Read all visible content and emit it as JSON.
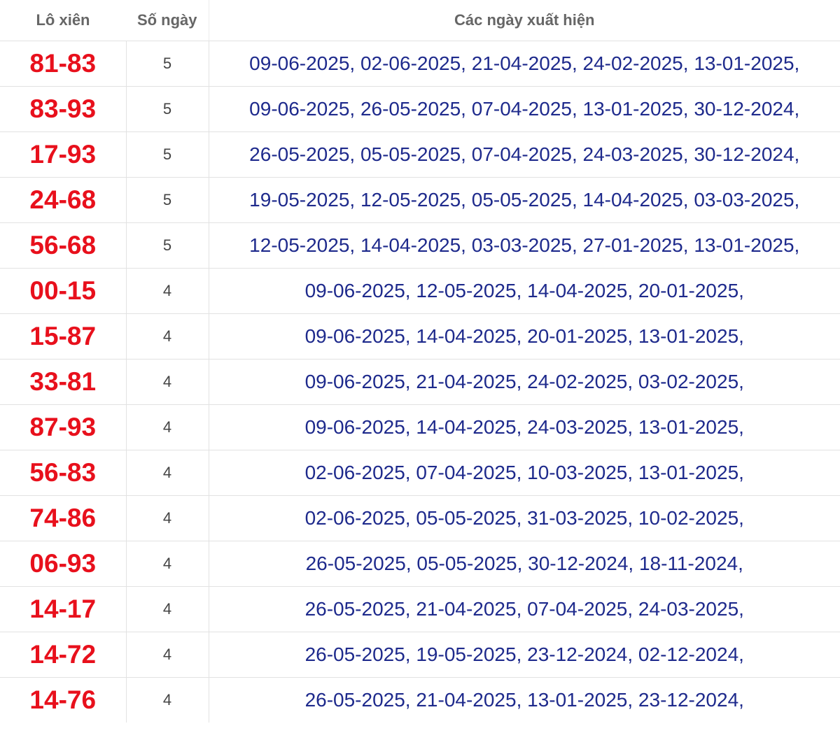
{
  "header": {
    "pair_label": "Lô xiên",
    "count_label": "Số ngày",
    "dates_label": "Các ngày xuất hiện"
  },
  "rows": [
    {
      "pair": "81-83",
      "count": "5",
      "dates": "09-06-2025, 02-06-2025, 21-04-2025, 24-02-2025, 13-01-2025,"
    },
    {
      "pair": "83-93",
      "count": "5",
      "dates": "09-06-2025, 26-05-2025, 07-04-2025, 13-01-2025, 30-12-2024,"
    },
    {
      "pair": "17-93",
      "count": "5",
      "dates": "26-05-2025, 05-05-2025, 07-04-2025, 24-03-2025, 30-12-2024,"
    },
    {
      "pair": "24-68",
      "count": "5",
      "dates": "19-05-2025, 12-05-2025, 05-05-2025, 14-04-2025, 03-03-2025,"
    },
    {
      "pair": "56-68",
      "count": "5",
      "dates": "12-05-2025, 14-04-2025, 03-03-2025, 27-01-2025, 13-01-2025,"
    },
    {
      "pair": "00-15",
      "count": "4",
      "dates": "09-06-2025, 12-05-2025, 14-04-2025, 20-01-2025,"
    },
    {
      "pair": "15-87",
      "count": "4",
      "dates": "09-06-2025, 14-04-2025, 20-01-2025, 13-01-2025,"
    },
    {
      "pair": "33-81",
      "count": "4",
      "dates": "09-06-2025, 21-04-2025, 24-02-2025, 03-02-2025,"
    },
    {
      "pair": "87-93",
      "count": "4",
      "dates": "09-06-2025, 14-04-2025, 24-03-2025, 13-01-2025,"
    },
    {
      "pair": "56-83",
      "count": "4",
      "dates": "02-06-2025, 07-04-2025, 10-03-2025, 13-01-2025,"
    },
    {
      "pair": "74-86",
      "count": "4",
      "dates": "02-06-2025, 05-05-2025, 31-03-2025, 10-02-2025,"
    },
    {
      "pair": "06-93",
      "count": "4",
      "dates": "26-05-2025, 05-05-2025, 30-12-2024, 18-11-2024,"
    },
    {
      "pair": "14-17",
      "count": "4",
      "dates": "26-05-2025, 21-04-2025, 07-04-2025, 24-03-2025,"
    },
    {
      "pair": "14-72",
      "count": "4",
      "dates": "26-05-2025, 19-05-2025, 23-12-2024, 02-12-2024,"
    },
    {
      "pair": "14-76",
      "count": "4",
      "dates": "26-05-2025, 21-04-2025, 13-01-2025, 23-12-2024,"
    }
  ]
}
